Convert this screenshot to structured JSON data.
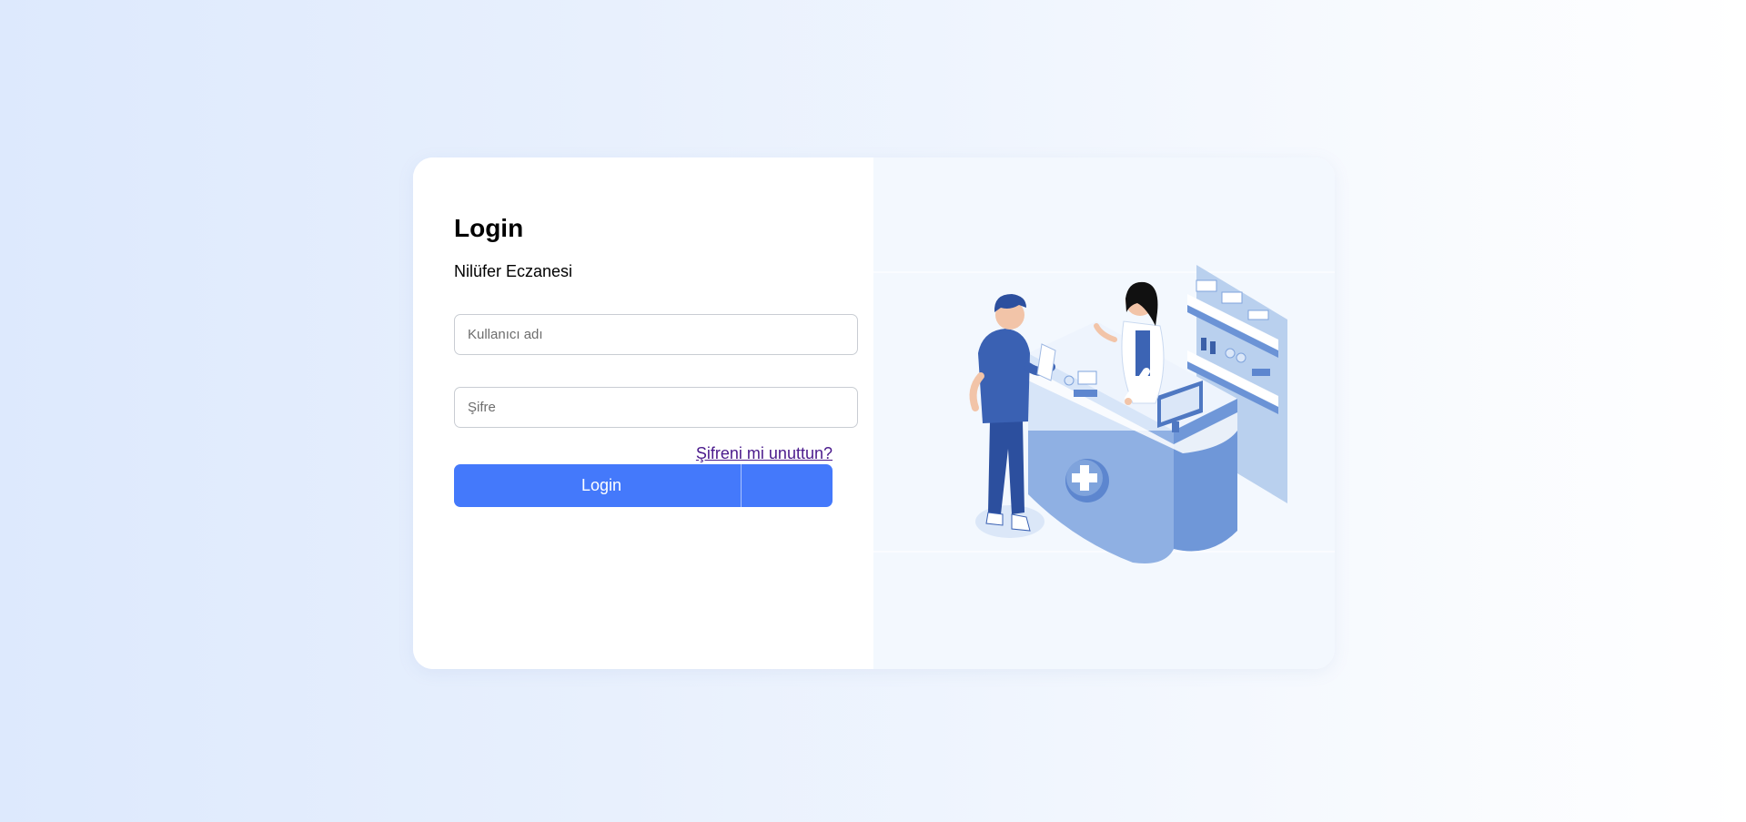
{
  "login": {
    "title": "Login",
    "subtitle": "Nilüfer Eczanesi",
    "username_placeholder": "Kullanıcı adı",
    "username_value": "",
    "password_placeholder": "Şifre",
    "password_value": "",
    "forgot_link": "Şifreni mi unuttun?",
    "submit_label": "Login"
  },
  "illustration": {
    "icon": "pharmacy-illustration"
  },
  "colors": {
    "accent": "#4479fb",
    "link": "#4a1a8c",
    "illustration_bg": "#f3f8fe"
  }
}
